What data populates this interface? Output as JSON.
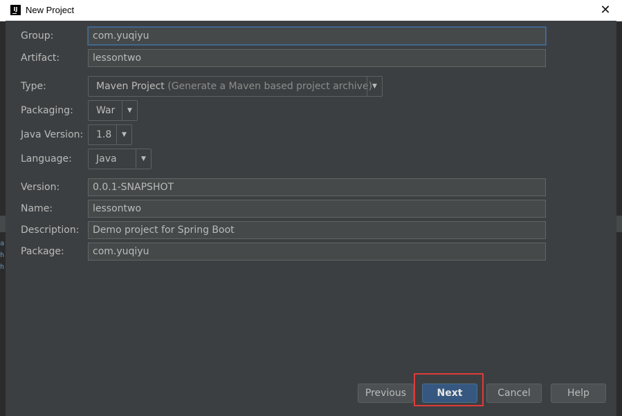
{
  "window": {
    "title": "New Project",
    "close_glyph": "✕",
    "app_icon_letter": "IJ",
    "icon_names": [
      "intellij-app-icon",
      "close-icon",
      "chevron-down-icon"
    ]
  },
  "background_glyphs": [
    "a",
    "h",
    "h"
  ],
  "form": {
    "group": {
      "label": "Group:",
      "value": "com.yuqiyu"
    },
    "artifact": {
      "label": "Artifact:",
      "value": "lessontwo"
    },
    "type": {
      "label": "Type:",
      "value": "Maven Project",
      "hint": "(Generate a Maven based project archive)"
    },
    "packaging": {
      "label": "Packaging:",
      "value": "War"
    },
    "java_version": {
      "label": "Java Version:",
      "value": "1.8"
    },
    "language": {
      "label": "Language:",
      "value": "Java"
    },
    "version": {
      "label": "Version:",
      "value": "0.0.1-SNAPSHOT"
    },
    "name": {
      "label": "Name:",
      "value": "lessontwo"
    },
    "description": {
      "label": "Description:",
      "value": "Demo project for Spring Boot"
    },
    "package": {
      "label": "Package:",
      "value": "com.yuqiyu"
    }
  },
  "buttons": {
    "previous": "Previous",
    "next": "Next",
    "cancel": "Cancel",
    "help": "Help"
  },
  "colors": {
    "background": "#3c3f41",
    "default_button": "#365880",
    "highlight": "#e03a3a"
  }
}
